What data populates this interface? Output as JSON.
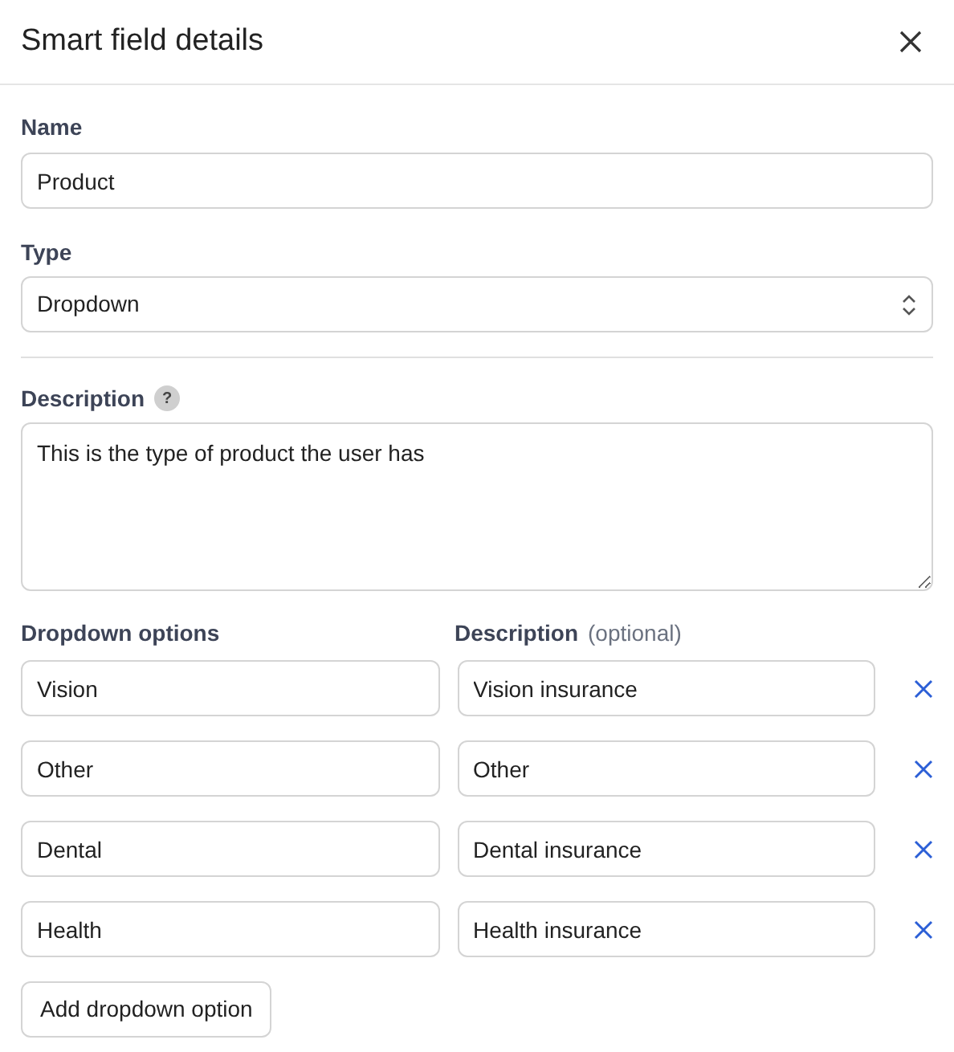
{
  "header": {
    "title": "Smart field details"
  },
  "name_field": {
    "label": "Name",
    "value": "Product"
  },
  "type_field": {
    "label": "Type",
    "value": "Dropdown"
  },
  "description_field": {
    "label": "Description",
    "help": "?",
    "value": "This is the type of product the user has"
  },
  "options": {
    "option_label": "Dropdown options",
    "description_label": "Description",
    "description_hint": "(optional)",
    "rows": [
      {
        "option": "Vision",
        "description": "Vision insurance"
      },
      {
        "option": "Other",
        "description": "Other"
      },
      {
        "option": "Dental",
        "description": "Dental insurance"
      },
      {
        "option": "Health",
        "description": "Health insurance"
      }
    ]
  },
  "add_button": "Add dropdown option"
}
